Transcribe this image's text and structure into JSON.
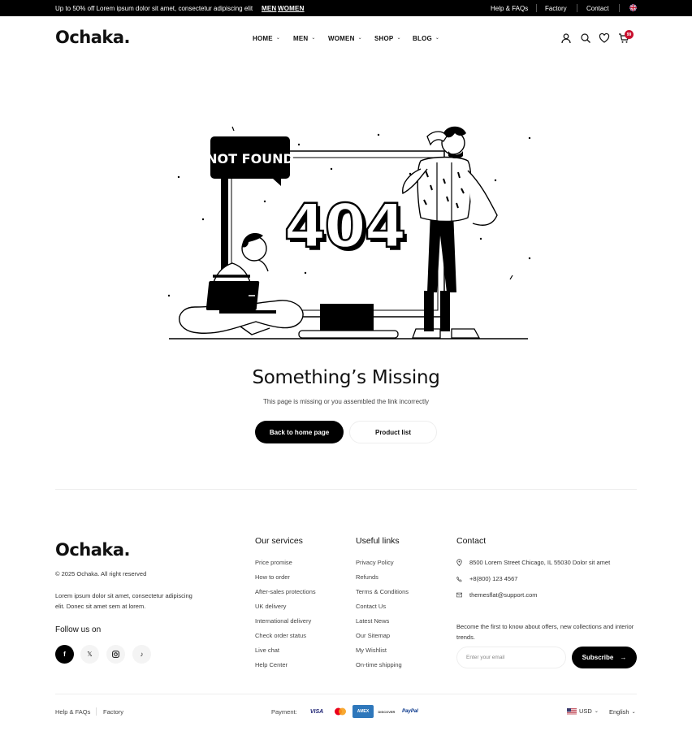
{
  "topbar": {
    "promo": "Up to 50% off Lorem ipsum dolor sit amet, consectetur adipiscing elit",
    "men": "MEN",
    "women": "WOMEN",
    "help": "Help & FAQs",
    "factory": "Factory",
    "contact": "Contact"
  },
  "header": {
    "logo": "Ochaka.",
    "nav": [
      "HOME",
      "MEN",
      "WOMEN",
      "SHOP",
      "BLOG"
    ],
    "cart_count": "99"
  },
  "illustration": {
    "sign": "NOT FOUND",
    "code": "404"
  },
  "error": {
    "title": "Something’s Missing",
    "subtitle": "This page is missing or you assembled the link incorrectly",
    "home_button": "Back to home page",
    "product_button": "Product list"
  },
  "footer": {
    "logo": "Ochaka.",
    "copyright": "© 2025 Ochaka. All right reserved",
    "about": "Lorem ipsum dolor sit amet, consectetur adipiscing elit. Donec sit amet sem at lorem.",
    "follow": "Follow us on",
    "social": [
      "facebook-icon",
      "x-icon",
      "instagram-icon",
      "tiktok-icon"
    ],
    "services": {
      "title": "Our services",
      "items": [
        "Price promise",
        "How to order",
        "After-sales protections",
        "UK delivery",
        "International delivery",
        "Check order status",
        "Live chat",
        "Help Center"
      ]
    },
    "links": {
      "title": "Useful links",
      "items": [
        "Privacy Policy",
        "Refunds",
        "Terms & Conditions",
        "Contact Us",
        "Latest News",
        "Our Sitemap",
        "My Wishlist",
        "On-time shipping"
      ]
    },
    "contact": {
      "title": "Contact",
      "address": "8500 Lorem Street  Chicago, IL 55030 Dolor sit amet",
      "phone": "+8(800) 123 4567",
      "email": "themesflat@support.com",
      "newsletter": "Become the first to know about offers, new collections and interior trends.",
      "placeholder": "Enter your email",
      "subscribe": "Subscribe"
    }
  },
  "bottom": {
    "help": "Help & FAQs",
    "factory": "Factory",
    "payment_label": "Payment:",
    "payments": [
      "VISA",
      "AMEX",
      "DISCOVER",
      "PayPal"
    ],
    "currency": "USD",
    "language": "English"
  },
  "colors": {
    "accent": "#000000",
    "badge": "#c8102e"
  }
}
